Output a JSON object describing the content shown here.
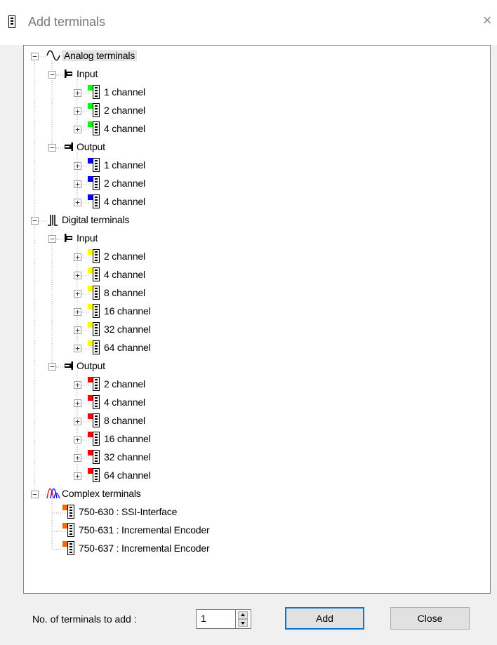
{
  "window": {
    "title": "Add terminals",
    "close_glyph": "×"
  },
  "tree": {
    "analog": {
      "label": "Analog terminals",
      "input_label": "Input",
      "input_items": [
        "1 channel",
        "2 channel",
        "4 channel"
      ],
      "output_label": "Output",
      "output_items": [
        "1 channel",
        "2 channel",
        "4 channel"
      ]
    },
    "digital": {
      "label": "Digital terminals",
      "input_label": "Input",
      "input_items": [
        "2 channel",
        "4 channel",
        "8 channel",
        "16 channel",
        "32 channel",
        "64 channel"
      ],
      "output_label": "Output",
      "output_items": [
        "2 channel",
        "4 channel",
        "8 channel",
        "16 channel",
        "32 channel",
        "64 channel"
      ]
    },
    "complex": {
      "label": "Complex terminals",
      "items": [
        "750-630 : SSI-Interface",
        "750-631 : Incremental Encoder",
        "750-637 : Incremental Encoder"
      ]
    }
  },
  "footer": {
    "count_label": "No. of terminals to add :",
    "count_value": "1",
    "add_label": "Add",
    "close_label": "Close"
  },
  "colors": {
    "analog_input": "#00ff00",
    "analog_output": "#0000ff",
    "digital_input": "#ffff00",
    "digital_output": "#ff0000",
    "complex": "#ff6600",
    "focus_border": "#0078d7"
  },
  "icons": {
    "title": "terminal-block-icon",
    "analog": "sine-wave-icon",
    "digital": "square-wave-icon",
    "complex": "multi-wave-icon",
    "input": "input-arrow-icon",
    "output": "output-arrow-icon",
    "terminal": "terminal-module-icon"
  }
}
